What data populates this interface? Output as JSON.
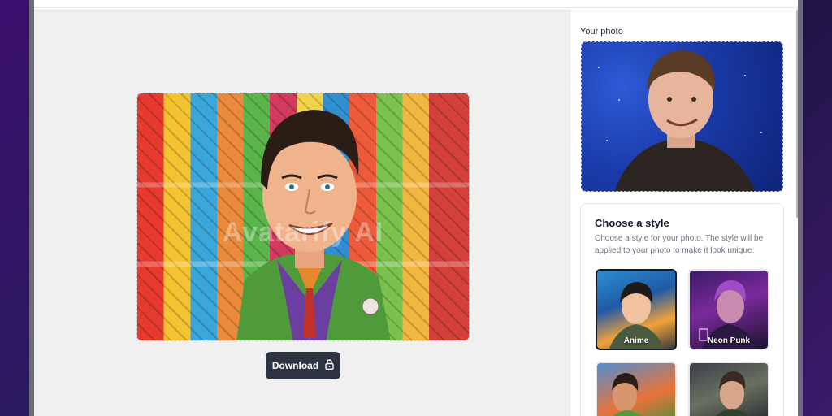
{
  "watermark": "Avatarify AI",
  "download": {
    "label": "Download",
    "icon": "lock-icon"
  },
  "sidebar": {
    "your_photo_label": "Your photo",
    "style_section": {
      "title": "Choose a style",
      "description": "Choose a style for your photo. The style will be applied to your photo to make it look unique.",
      "styles": [
        {
          "label": "Anime",
          "selected": true
        },
        {
          "label": "Neon Punk",
          "selected": false
        },
        {
          "label": "",
          "selected": false
        },
        {
          "label": "",
          "selected": false
        }
      ]
    }
  },
  "colors": {
    "button_bg": "#2d3340",
    "selected_border": "#111827",
    "canvas_bg": "#f0f0f1"
  }
}
